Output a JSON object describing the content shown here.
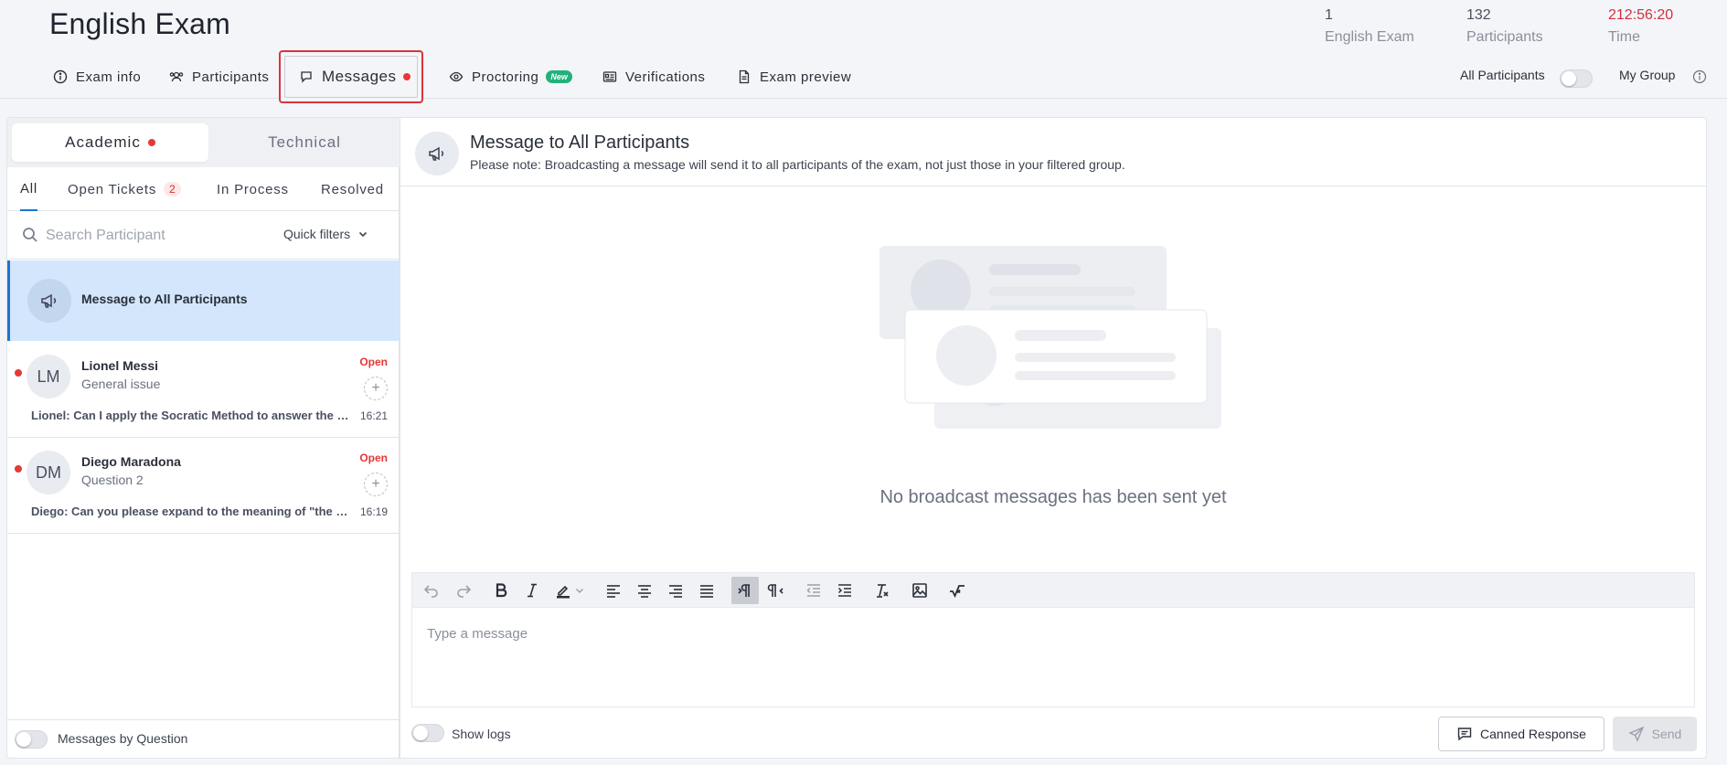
{
  "header": {
    "title": "English Exam",
    "stats": [
      {
        "value": "1",
        "label": "English Exam"
      },
      {
        "value": "132",
        "label": "Participants"
      },
      {
        "value": "212:56:20",
        "label": "Time"
      }
    ]
  },
  "nav": {
    "tabs": [
      {
        "label": "Exam info",
        "icon": "info-icon"
      },
      {
        "label": "Participants",
        "icon": "participants-icon"
      },
      {
        "label": "Messages",
        "icon": "chat-icon",
        "unread": true
      },
      {
        "label": "Proctoring",
        "icon": "eye-icon",
        "badge": "New"
      },
      {
        "label": "Verifications",
        "icon": "id-card-icon"
      },
      {
        "label": "Exam preview",
        "icon": "document-icon"
      }
    ],
    "active_tab": "Messages",
    "scope_left": "All Participants",
    "scope_right": "My Group",
    "scope_toggle_on": false
  },
  "sidebar": {
    "segments": [
      {
        "label": "Academic",
        "unread": true
      },
      {
        "label": "Technical"
      }
    ],
    "filters": [
      {
        "label": "All"
      },
      {
        "label": "Open Tickets",
        "count": "2"
      },
      {
        "label": "In Process"
      },
      {
        "label": "Resolved"
      }
    ],
    "search_placeholder": "Search Participant",
    "quick_filters": "Quick filters",
    "broadcast_item": "Message to All Participants",
    "tickets": [
      {
        "initials": "LM",
        "name": "Lionel Messi",
        "topic": "General issue",
        "status": "Open",
        "preview": "Lionel: Can I apply the Socratic Method to answer the question?",
        "time": "16:21"
      },
      {
        "initials": "DM",
        "name": "Diego Maradona",
        "topic": "Question 2",
        "status": "Open",
        "preview": "Diego: Can you please expand to the meaning of \"the paragraph\"?",
        "time": "16:19"
      }
    ],
    "footer_toggle_label": "Messages by Question"
  },
  "main": {
    "title": "Message to All Participants",
    "subtitle": "Please note: Broadcasting a message will send it to all participants of the exam, not just those in your filtered group.",
    "empty_text": "No broadcast messages has been sent yet",
    "editor_placeholder": "Type a message",
    "show_logs_label": "Show logs",
    "canned_response_label": "Canned Response",
    "send_label": "Send"
  },
  "colors": {
    "accent": "#1976d2",
    "alert": "#e53935",
    "selected_bg": "#d3e6fb",
    "highlight_border": "#d9343c",
    "badge_new": "#20b27a"
  }
}
